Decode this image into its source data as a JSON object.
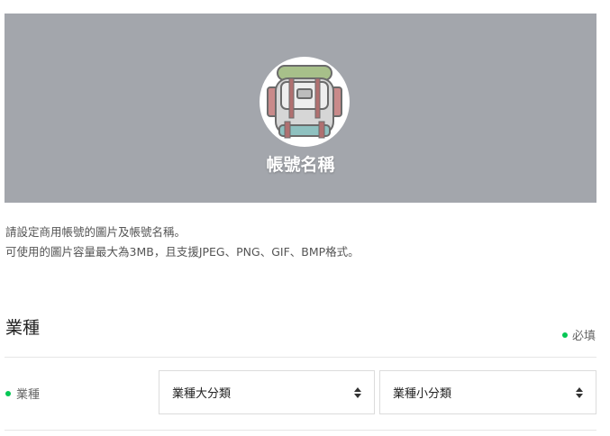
{
  "profile": {
    "account_name": "帳號名稱"
  },
  "description": {
    "line1": "請設定商用帳號的圖片及帳號名稱。",
    "line2": "可使用的圖片容量最大為3MB，且支援JPEG、PNG、GIF、BMP格式。"
  },
  "industry_section": {
    "title": "業種",
    "required_label": "必填",
    "field_label": "業種",
    "major_select": {
      "value": "業種大分類"
    },
    "minor_select": {
      "value": "業種小分類"
    }
  },
  "colors": {
    "banner": "#a3a6ac",
    "required_dot": "#06c755"
  },
  "icons": [
    "backpack-avatar-icon",
    "required-dot-icon",
    "select-arrows-icon"
  ]
}
